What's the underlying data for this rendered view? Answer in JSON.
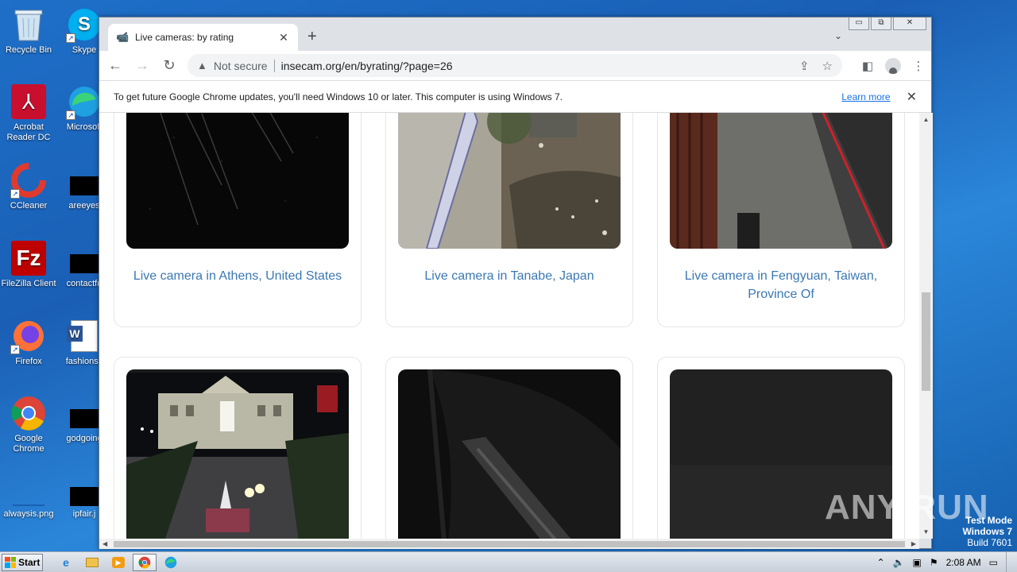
{
  "desktop": {
    "icons_left": [
      {
        "label": "Recycle Bin",
        "icon": "recycle-bin-icon"
      },
      {
        "label": "Acrobat Reader DC",
        "icon": "acrobat-icon"
      },
      {
        "label": "CCleaner",
        "icon": "ccleaner-icon"
      },
      {
        "label": "FileZilla Client",
        "icon": "filezilla-icon"
      },
      {
        "label": "Firefox",
        "icon": "firefox-icon"
      },
      {
        "label": "Google Chrome",
        "icon": "chrome-icon"
      },
      {
        "label": "alwaysis.png",
        "icon": "image-file-icon"
      }
    ],
    "icons_right": [
      {
        "label": "Skype",
        "icon": "skype-icon"
      },
      {
        "label": "Microsoft",
        "icon": "edge-icon"
      },
      {
        "label": "areeyes",
        "icon": "file-icon"
      },
      {
        "label": "contactfri",
        "icon": "file-icon"
      },
      {
        "label": "fashionsy",
        "icon": "word-icon"
      },
      {
        "label": "godgoing",
        "icon": "file-icon"
      },
      {
        "label": "ipfair.j",
        "icon": "file-icon"
      }
    ]
  },
  "browser": {
    "tab": {
      "title": "Live cameras: by rating",
      "close": "✕"
    },
    "new_tab": "+",
    "window_controls": {
      "minimize": "▭",
      "restore": "⧉",
      "close": "✕"
    },
    "omnibox": {
      "security": "Not secure",
      "url": "insecam.org/en/byrating/?page=26"
    },
    "infobar": {
      "message": "To get future Google Chrome updates, you'll need Windows 10 or later. This computer is using Windows 7.",
      "link": "Learn more",
      "close": "✕"
    }
  },
  "page": {
    "cameras": [
      {
        "caption": "Live camera in Athens, United States",
        "scene": "dark-road"
      },
      {
        "caption": "Live camera in Tanabe, Japan",
        "scene": "river-wall"
      },
      {
        "caption": "Live camera in Fengyuan, Taiwan, Province Of",
        "scene": "street-curb"
      },
      {
        "caption": "",
        "scene": "town-square-night"
      },
      {
        "caption": "",
        "scene": "dark-dome"
      },
      {
        "caption": "",
        "scene": "dark-grey"
      }
    ]
  },
  "taskbar": {
    "start_label": "Start",
    "clock": "2:08 AM",
    "apps": [
      "ie-icon",
      "explorer-icon",
      "media-player-icon",
      "chrome-icon",
      "edge-icon"
    ]
  },
  "watermark": {
    "line1": "Test Mode",
    "line2": "Windows 7",
    "line3": "Build 7601",
    "brand": "ANY RUN"
  },
  "colors": {
    "link": "#3b78b3",
    "chrome_blue": "#1a73e8",
    "desktop": "#1a5fb5"
  }
}
